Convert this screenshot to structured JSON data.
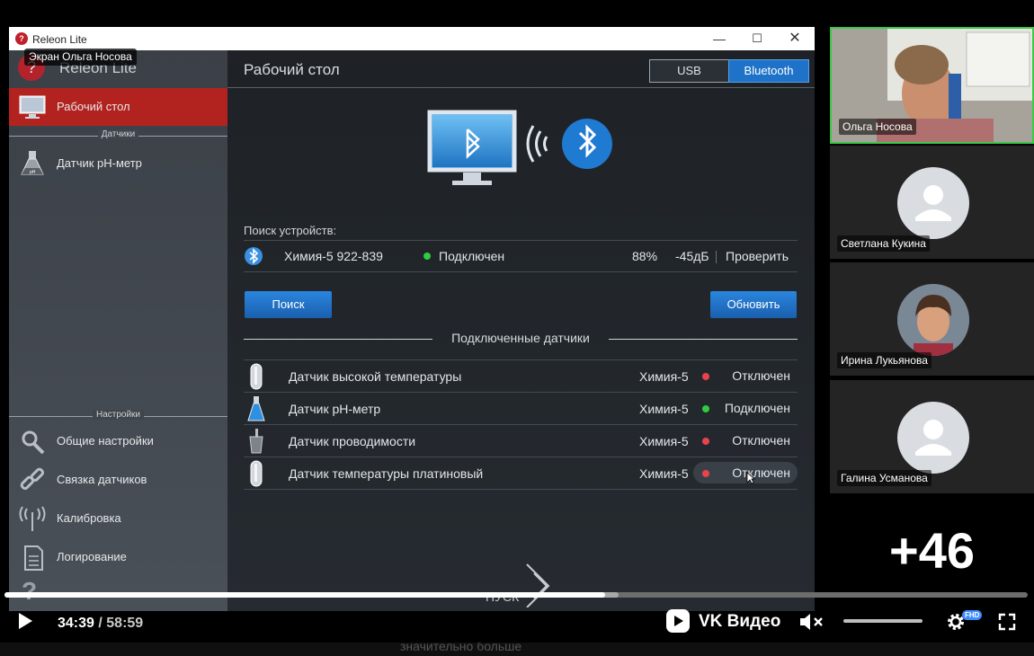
{
  "window": {
    "title": "Releon Lite"
  },
  "screen_share_label": "Экран Ольга Носова",
  "sidebar": {
    "brand": "Releon Lite",
    "top_items": [
      {
        "label": "Рабочий стол",
        "icon": "monitor-icon",
        "active": true
      }
    ],
    "sensors_header": "Датчики",
    "sensor_items": [
      {
        "label": "Датчик pH-метр",
        "icon": "flask-icon"
      }
    ],
    "settings_header": "Настройки",
    "settings_items": [
      {
        "label": "Общие настройки",
        "icon": "wrench-gear-icon"
      },
      {
        "label": "Связка датчиков",
        "icon": "chain-link-icon"
      },
      {
        "label": "Калибровка",
        "icon": "antenna-icon"
      },
      {
        "label": "Логирование",
        "icon": "document-icon"
      }
    ]
  },
  "main": {
    "title": "Рабочий стол",
    "connection_tabs": {
      "usb": "USB",
      "bluetooth": "Bluetooth",
      "selected": "Bluetooth"
    },
    "search_label": "Поиск устройств:",
    "device": {
      "name": "Химия-5 922-839",
      "status": "Подключен",
      "status_color": "#2ecc40",
      "battery": "88%",
      "signal": "-45дБ",
      "check": "Проверить"
    },
    "search_button": "Поиск",
    "refresh_button": "Обновить",
    "connected_header": "Подключенные датчики",
    "sensors": [
      {
        "name": "Датчик высокой температуры",
        "device": "Химия-5",
        "status": "Отключен",
        "dot": "#e8424c",
        "icon": "temp-probe-icon"
      },
      {
        "name": "Датчик pH-метр",
        "device": "Химия-5",
        "status": "Подключен",
        "dot": "#2ecc40",
        "icon": "flask-icon"
      },
      {
        "name": "Датчик проводимости",
        "device": "Химия-5",
        "status": "Отключен",
        "dot": "#e8424c",
        "icon": "beaker-icon"
      },
      {
        "name": "Датчик температуры платиновый",
        "device": "Химия-5",
        "status": "Отключен",
        "dot": "#e8424c",
        "icon": "temp-probe-icon"
      }
    ],
    "start_button": "ПУСК"
  },
  "participants": [
    {
      "name": "Ольга Носова",
      "video": true
    },
    {
      "name": "Светлана Кукина",
      "video": false
    },
    {
      "name": "Ирина Лукьянова",
      "video": false
    },
    {
      "name": "Галина Усманова",
      "video": false
    }
  ],
  "more_participants": "+46",
  "player": {
    "current_time": "34:39",
    "separator": "/",
    "duration": "58:59",
    "progress_fraction": 0.587,
    "buffered_fraction": 0.6,
    "brand": "VK Видео",
    "quality_badge": "FHD"
  },
  "bottom_caption": "значительно больше"
}
